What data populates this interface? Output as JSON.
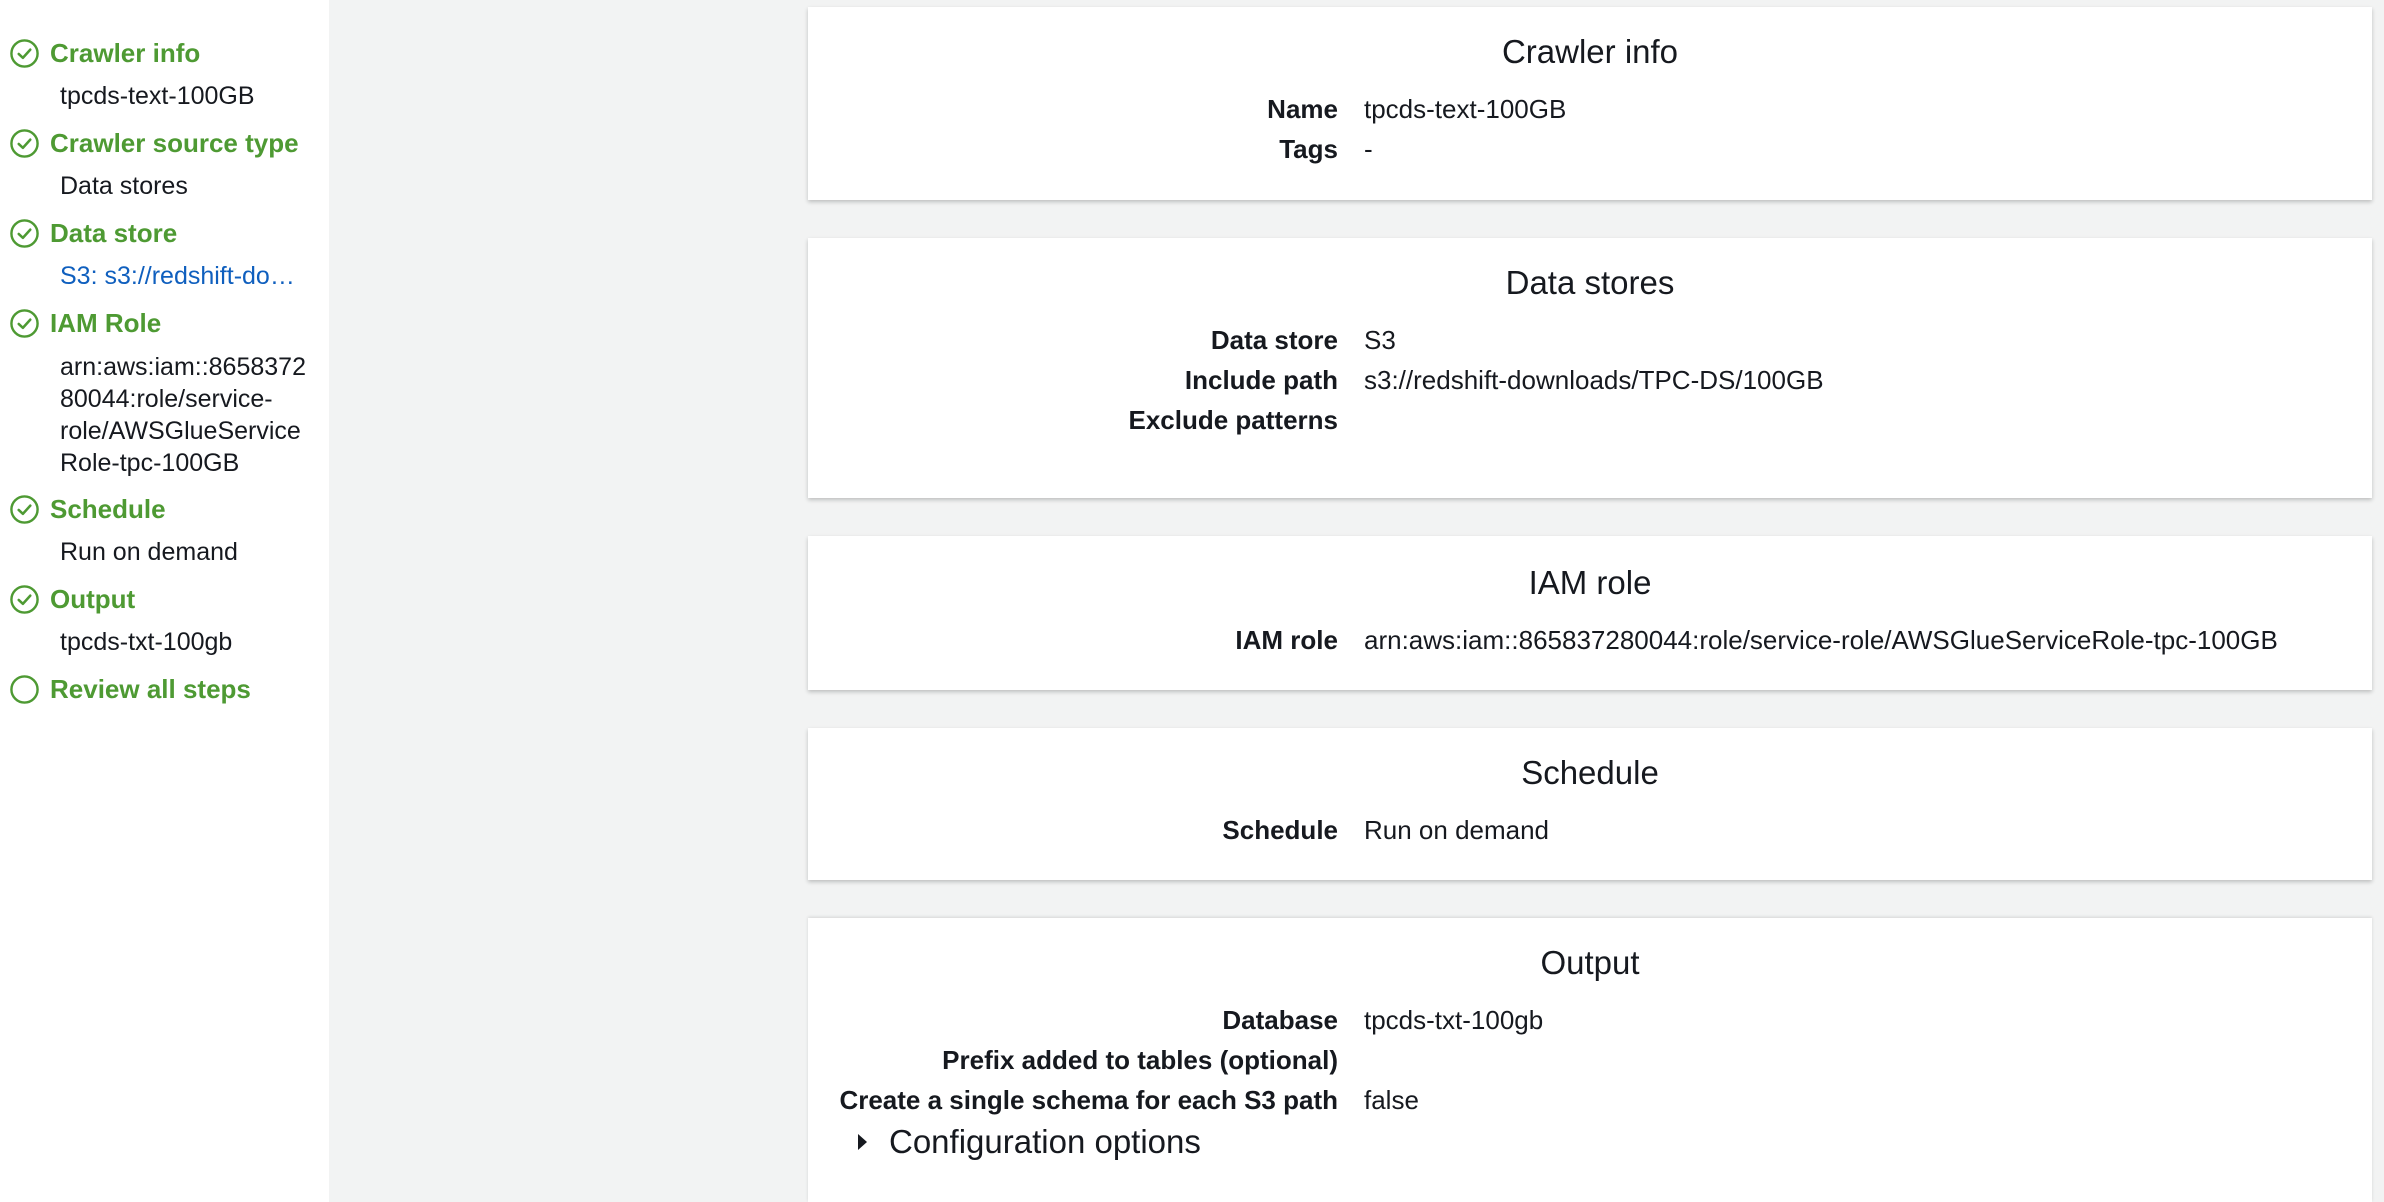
{
  "sidebar": {
    "steps": [
      {
        "label": "Crawler info",
        "sub": [
          "tpcds-text-100GB"
        ],
        "complete": true
      },
      {
        "label": "Crawler source type",
        "sub": [
          "Data stores"
        ],
        "complete": true
      },
      {
        "label": "Data store",
        "sub": [
          "S3: s3://redshift-downloads/TPC-DS/100GB"
        ],
        "complete": true
      },
      {
        "label": "IAM Role",
        "sub": [
          "arn:aws:iam::8658372",
          "80044:role/service-",
          "role/AWSGlueService",
          "Role-tpc-100GB"
        ],
        "complete": true
      },
      {
        "label": "Schedule",
        "sub": [
          "Run on demand"
        ],
        "complete": true
      },
      {
        "label": "Output",
        "sub": [
          "tpcds-txt-100gb"
        ],
        "complete": true
      },
      {
        "label": "Review all steps",
        "sub": [],
        "complete": false
      }
    ]
  },
  "cards": {
    "crawler_info": {
      "title": "Crawler info",
      "name_label": "Name",
      "name_value": "tpcds-text-100GB",
      "tags_label": "Tags",
      "tags_value": "-"
    },
    "data_stores": {
      "title": "Data stores",
      "store_label": "Data store",
      "store_value": "S3",
      "include_label": "Include path",
      "include_value": "s3://redshift-downloads/TPC-DS/100GB",
      "exclude_label": "Exclude patterns",
      "exclude_value": ""
    },
    "iam_role": {
      "title": "IAM role",
      "role_label": "IAM role",
      "role_value": "arn:aws:iam::865837280044:role/service-role/AWSGlueServiceRole-tpc-100GB"
    },
    "schedule": {
      "title": "Schedule",
      "schedule_label": "Schedule",
      "schedule_value": "Run on demand"
    },
    "output": {
      "title": "Output",
      "database_label": "Database",
      "database_value": "tpcds-txt-100gb",
      "prefix_label": "Prefix added to tables (optional)",
      "prefix_value": "",
      "single_schema_label": "Create a single schema for each S3 path",
      "single_schema_value": "false",
      "config_label": "Configuration options"
    }
  },
  "colors": {
    "step_green": "#4e9a33",
    "link_blue": "#0f5fbe",
    "background": "#f2f3f3"
  },
  "icons": {
    "complete": "check-circle-icon",
    "pending": "empty-circle-icon",
    "expand": "caret-right-icon"
  }
}
